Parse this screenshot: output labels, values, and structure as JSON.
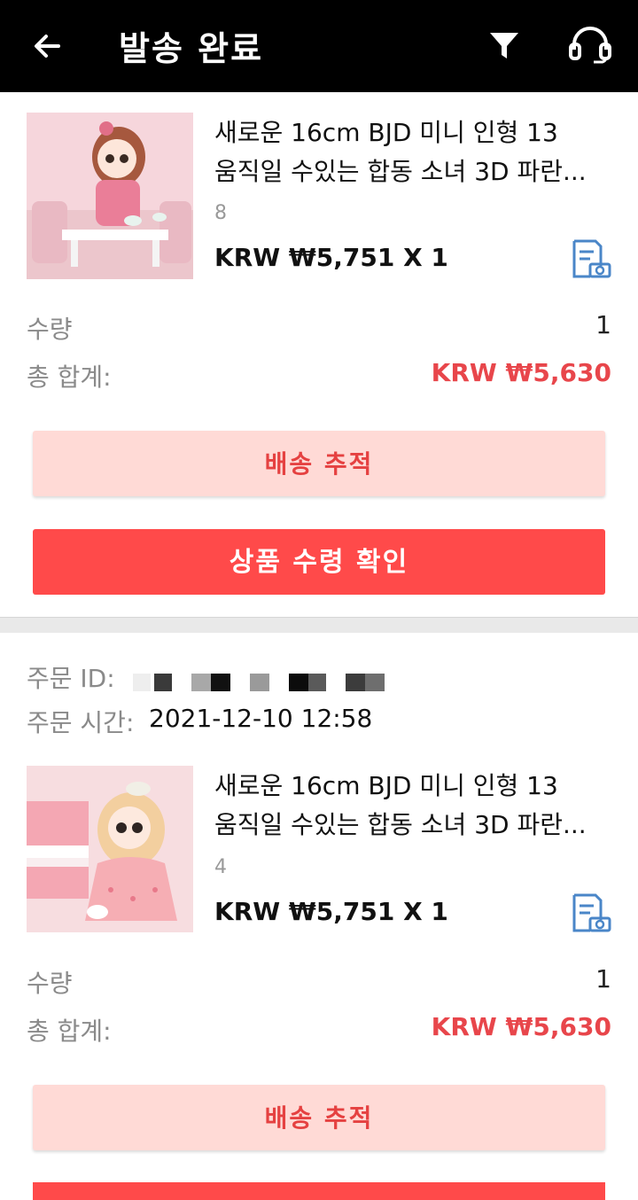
{
  "header": {
    "title": "발송 완료",
    "back_icon": "arrow-left-icon",
    "filter_icon": "filter-icon",
    "support_icon": "headset-icon"
  },
  "orders": [
    {
      "product_name_line1": "새로운 16cm BJD 미니 인형 13",
      "product_name_line2": "움직일 수있는 합동 소녀 3D 파란...",
      "variant": "8",
      "price_line": "KRW ₩5,751 X 1",
      "quantity_label": "수량",
      "quantity_value": "1",
      "total_label": "총 합계:",
      "total_value": "KRW ₩5,630",
      "track_button": "배송 추적",
      "confirm_button": "상품 수령 확인"
    },
    {
      "order_id_label": "주문 ID:",
      "order_time_label": "주문 시간:",
      "order_time_value": "2021-12-10 12:58",
      "product_name_line1": "새로운 16cm BJD 미니 인형 13",
      "product_name_line2": "움직일 수있는 합동 소녀 3D 파란...",
      "variant": "4",
      "price_line": "KRW ₩5,751 X 1",
      "quantity_label": "수량",
      "quantity_value": "1",
      "total_label": "총 합계:",
      "total_value": "KRW ₩5,630",
      "track_button": "배송 추적"
    }
  ],
  "colors": {
    "header_bg": "#000000",
    "accent_red": "#ff4a4a",
    "price_red": "#e8464b",
    "track_bg": "#ffdad6",
    "receipt_icon": "#4a86c8"
  }
}
